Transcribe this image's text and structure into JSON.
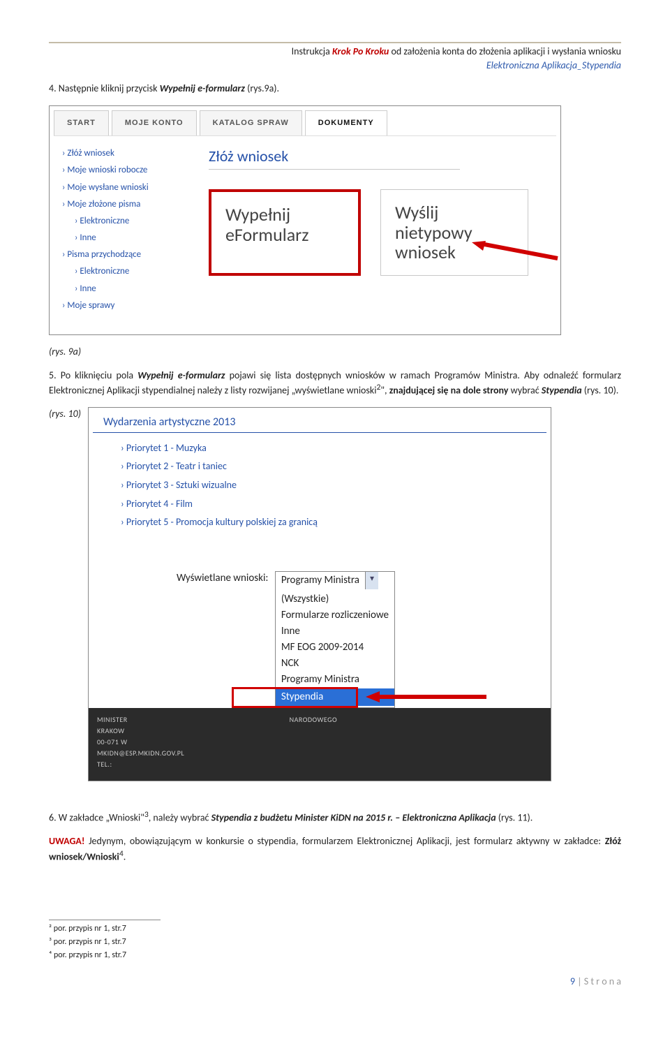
{
  "header": {
    "prefix": "Instrukcja",
    "kpk": "Krok Po Kroku",
    "suffix": "od założenia konta do złożenia aplikacji i wysłania wniosku",
    "subtitle": "Elektroniczna Aplikacja_Stypendia"
  },
  "step4": {
    "prefix": "4. Następnie kliknij przycisk",
    "bold": "Wypełnij e-formularz",
    "suffix": "(rys.9a)."
  },
  "fig9a": {
    "tabs": [
      "START",
      "MOJE KONTO",
      "KATALOG SPRAW",
      "DOKUMENTY"
    ],
    "sidemenu": {
      "items": [
        "Złóż wniosek",
        "Moje wnioski robocze",
        "Moje wysłane wnioski",
        "Moje złożone pisma"
      ],
      "subs1": [
        "Elektroniczne",
        "Inne"
      ],
      "item5": "Pisma przychodzące",
      "subs2": [
        "Elektroniczne",
        "Inne"
      ],
      "item6": "Moje sprawy"
    },
    "heading": "Złóż wniosek",
    "card1_l1": "Wypełnij",
    "card1_l2": "eFormularz",
    "card2_l1": "Wyślij nietypowy",
    "card2_l2": "wniosek",
    "caption": "(rys. 9a)"
  },
  "step5": {
    "prefix": "5. Po kliknięciu pola",
    "bold": "Wypełnij e-formularz",
    "mid": "pojawi się lista dostępnych wniosków w ramach Programów Ministra. Aby odnaleźć formularz Elektronicznej Aplikacji stypendialnej należy z  listy rozwijanej „wyświetlane wnioski",
    "sup": "2",
    "mid2": "\",",
    "bold2": "znajdującej się na dole strony",
    "mid3": "wybrać",
    "ital": "Stypendia",
    "suffix": "(rys. 10)."
  },
  "fig10": {
    "caption": "(rys. 10)",
    "heading": "Wydarzenia artystyczne 2013",
    "priorities": [
      "Priorytet 1 - Muzyka",
      "Priorytet 2 - Teatr i taniec",
      "Priorytet 3 - Sztuki wizualne",
      "Priorytet 4 - Film",
      "Priorytet 5 - Promocja kultury polskiej za granicą"
    ],
    "label": "Wyświetlane wnioski:",
    "selected": "Programy Ministra",
    "options": [
      "(Wszystkie)",
      "Formularze rozliczeniowe",
      "Inne",
      "MF EOG 2009-2014",
      "NCK",
      "Programy Ministra",
      "Stypendia"
    ],
    "footer": {
      "l1": "MINISTER",
      "l1b": "NARODOWEGO",
      "l2": "KRAKOW",
      "l3": "00-071 W",
      "l4": "MKIDN@ESP.MKIDN.GOV.PL",
      "l5": "TEL.:"
    }
  },
  "step6": {
    "prefix": "6. W zakładce „Wnioski\"",
    "sup": "3",
    "mid": ", należy wybrać",
    "ital": "Stypendia z budżetu Minister KiDN na 2015 r. – Elektroniczna Aplikacja",
    "suffix": "(rys. 11)."
  },
  "uwaga": {
    "label": "UWAGA!",
    "text1": "Jedynym, obowiązującym w konkursie o stypendia, formularzem Elektronicznej Aplikacji, jest formularz aktywny w zakładce:",
    "bold": "Złóż wniosek/Wnioski",
    "sup": "4",
    "suffix": "."
  },
  "footnotes": {
    "f2": "² por. przypis nr 1, str.7",
    "f3": "³ por. przypis nr 1, str.7",
    "f4": "⁴ por. przypis nr 1, str.7"
  },
  "pagefooter": {
    "n": "9",
    "sep": " | ",
    "word": "S t r o n a"
  }
}
